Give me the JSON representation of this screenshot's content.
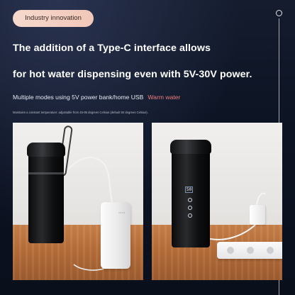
{
  "badge": {
    "label": "Industry innovation"
  },
  "headline": {
    "line1": "The addition of a Type-C interface allows",
    "line2": "for hot water dispensing even with 5V-30V power."
  },
  "modes": {
    "text": "Multiple modes using 5V power bank/home USB",
    "highlight": "Warm water"
  },
  "fine_print": "Maintains a constant temperature: adjustable from 45-85 degrees Celsius (default 50 degrees Celsius).",
  "display": {
    "value": "50"
  },
  "colors": {
    "background": "#0b1220",
    "badge_bg": "#f6d9cd",
    "highlight": "#f07d7d",
    "wood": "#b66e3a"
  },
  "icons": [
    "ring-indicator-icon",
    "bottle-device",
    "power-bank",
    "usb-charger",
    "power-strip"
  ]
}
